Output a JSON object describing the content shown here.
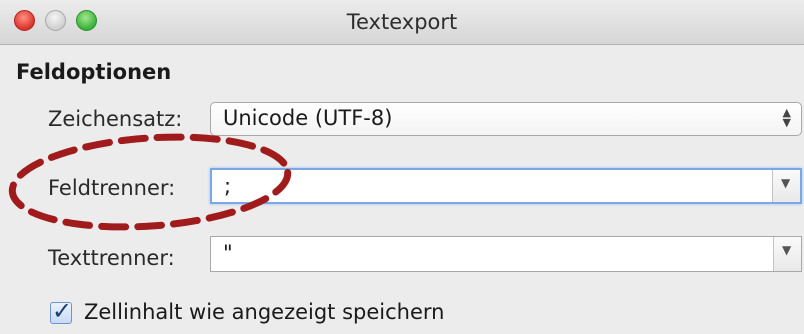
{
  "window": {
    "title": "Textexport",
    "controls": [
      "close-icon",
      "minimize-icon",
      "zoom-icon"
    ]
  },
  "section": {
    "title": "Feldoptionen"
  },
  "fields": {
    "charset": {
      "label": "Zeichensatz:",
      "value": "Unicode (UTF-8)",
      "icon": "up-down-arrows-icon"
    },
    "field_separator": {
      "label": "Feldtrenner:",
      "value": ";",
      "icon": "chevron-down-icon"
    },
    "text_separator": {
      "label": "Texttrenner:",
      "value": "\"",
      "icon": "chevron-down-icon"
    }
  },
  "checkbox": {
    "label": "Zellinhalt wie angezeigt speichern",
    "checked": true
  },
  "annotation": {
    "shape": "dashed-ellipse",
    "color": "#a01c1c"
  }
}
